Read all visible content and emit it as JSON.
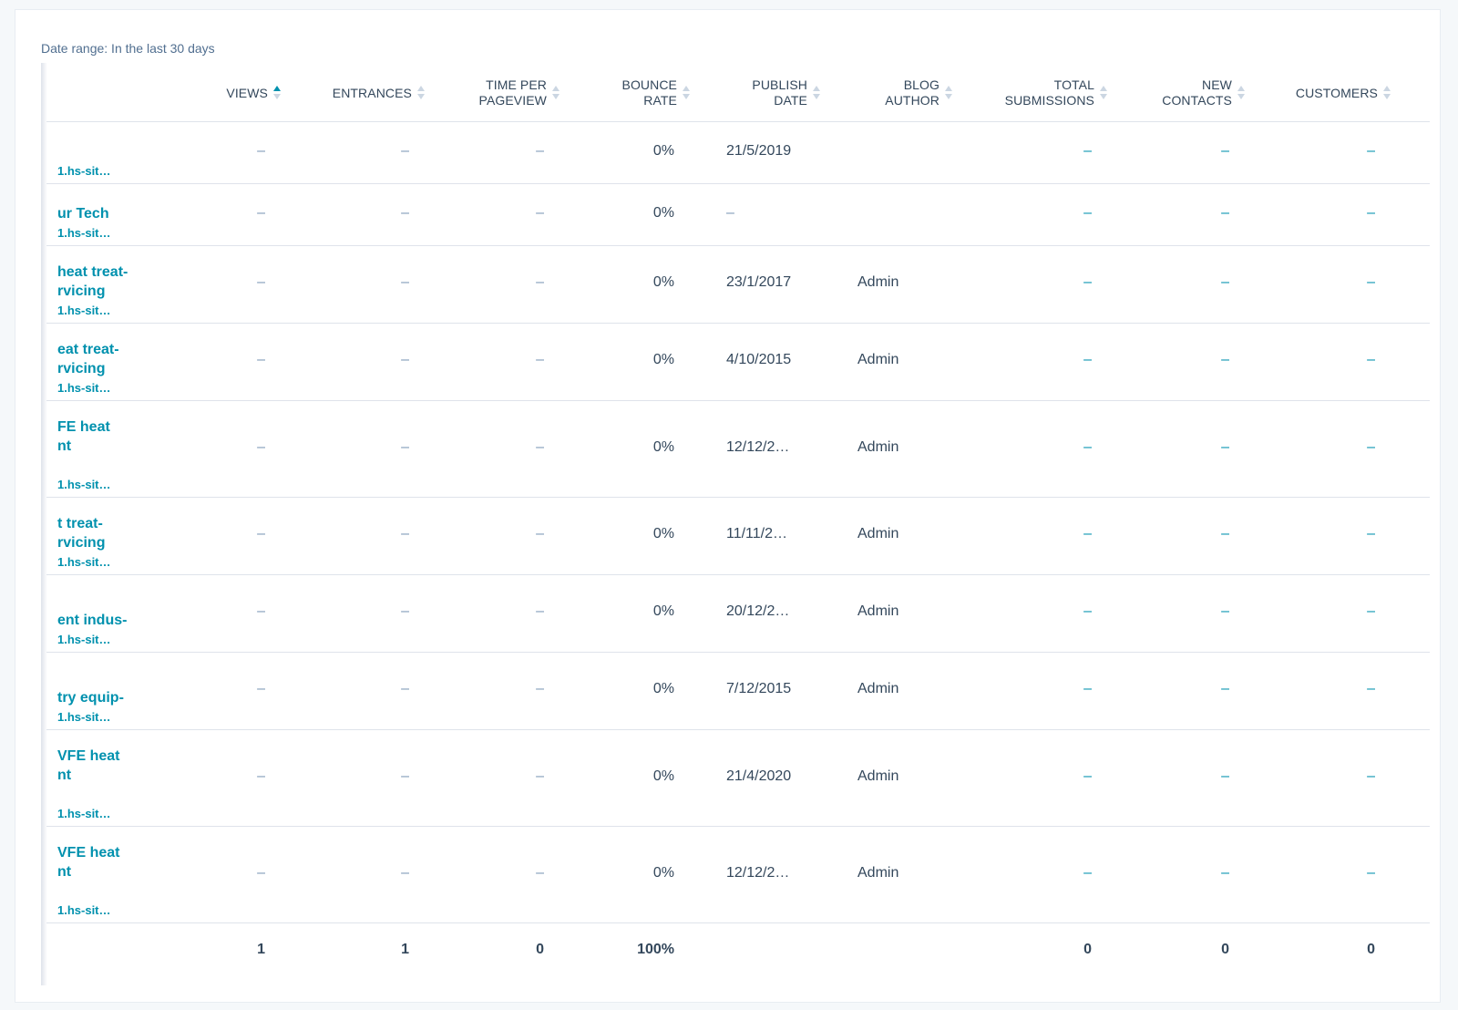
{
  "date_range": "Date range: In the last 30 days",
  "columns": [
    {
      "label": "VIEWS",
      "sort": "asc"
    },
    {
      "label": "ENTRANCES",
      "sort": "none"
    },
    {
      "label": "TIME PER\nPAGEVIEW",
      "sort": "none"
    },
    {
      "label": "BOUNCE\nRATE",
      "sort": "none"
    },
    {
      "label": "PUBLISH\nDATE",
      "sort": "none"
    },
    {
      "label": "BLOG\nAUTHOR",
      "sort": "none"
    },
    {
      "label": "TOTAL\nSUBMISSIONS",
      "sort": "none"
    },
    {
      "label": "NEW\nCONTACTS",
      "sort": "none"
    },
    {
      "label": "CUSTOMERS",
      "sort": "none"
    }
  ],
  "rows": [
    {
      "title": "",
      "url": "1.hs-sit…",
      "views": "–",
      "entrances": "–",
      "time_per_pageview": "–",
      "bounce_rate": "0%",
      "publish_date": "21/5/2019",
      "blog_author": "",
      "total_submissions": "–",
      "new_contacts": "–",
      "customers": "–"
    },
    {
      "title": "ur Tech",
      "url": "1.hs-sit…",
      "views": "–",
      "entrances": "–",
      "time_per_pageview": "–",
      "bounce_rate": "0%",
      "publish_date": "–",
      "blog_author": "",
      "total_submissions": "–",
      "new_contacts": "–",
      "customers": "–"
    },
    {
      "title": "heat treat-\nrvicing",
      "url": "1.hs-sit…",
      "views": "–",
      "entrances": "–",
      "time_per_pageview": "–",
      "bounce_rate": "0%",
      "publish_date": "23/1/2017",
      "blog_author": "Admin",
      "total_submissions": "–",
      "new_contacts": "–",
      "customers": "–"
    },
    {
      "title": "eat treat-\nrvicing",
      "url": "1.hs-sit…",
      "views": "–",
      "entrances": "–",
      "time_per_pageview": "–",
      "bounce_rate": "0%",
      "publish_date": "4/10/2015",
      "blog_author": "Admin",
      "total_submissions": "–",
      "new_contacts": "–",
      "customers": "–"
    },
    {
      "title": "FE heat\nnt",
      "url": "1.hs-sit…",
      "views": "–",
      "entrances": "–",
      "time_per_pageview": "–",
      "bounce_rate": "0%",
      "publish_date": "12/12/2…",
      "blog_author": "Admin",
      "total_submissions": "–",
      "new_contacts": "–",
      "customers": "–"
    },
    {
      "title": "t treat-\nrvicing",
      "url": "1.hs-sit…",
      "views": "–",
      "entrances": "–",
      "time_per_pageview": "–",
      "bounce_rate": "0%",
      "publish_date": "11/11/2…",
      "blog_author": "Admin",
      "total_submissions": "–",
      "new_contacts": "–",
      "customers": "–"
    },
    {
      "title": "ent indus-",
      "url": "1.hs-sit…",
      "views": "–",
      "entrances": "–",
      "time_per_pageview": "–",
      "bounce_rate": "0%",
      "publish_date": "20/12/2…",
      "blog_author": "Admin",
      "total_submissions": "–",
      "new_contacts": "–",
      "customers": "–"
    },
    {
      "title": "try equip-",
      "url": "1.hs-sit…",
      "views": "–",
      "entrances": "–",
      "time_per_pageview": "–",
      "bounce_rate": "0%",
      "publish_date": "7/12/2015",
      "blog_author": "Admin",
      "total_submissions": "–",
      "new_contacts": "–",
      "customers": "–"
    },
    {
      "title": "VFE heat\nnt",
      "url": "1.hs-sit…",
      "views": "–",
      "entrances": "–",
      "time_per_pageview": "–",
      "bounce_rate": "0%",
      "publish_date": "21/4/2020",
      "blog_author": "Admin",
      "total_submissions": "–",
      "new_contacts": "–",
      "customers": "–"
    },
    {
      "title": "VFE heat\nnt",
      "url": "1.hs-sit…",
      "views": "–",
      "entrances": "–",
      "time_per_pageview": "–",
      "bounce_rate": "0%",
      "publish_date": "12/12/2…",
      "blog_author": "Admin",
      "total_submissions": "–",
      "new_contacts": "–",
      "customers": "–"
    }
  ],
  "totals": {
    "views": "1",
    "entrances": "1",
    "time_per_pageview": "0",
    "bounce_rate": "100%",
    "total_submissions": "0",
    "new_contacts": "0",
    "customers": "0"
  },
  "colors": {
    "link": "#0091ae",
    "text": "#33475b",
    "muted": "#7c98b6",
    "border": "#dfe3eb",
    "sort_active": "#0091ae"
  }
}
